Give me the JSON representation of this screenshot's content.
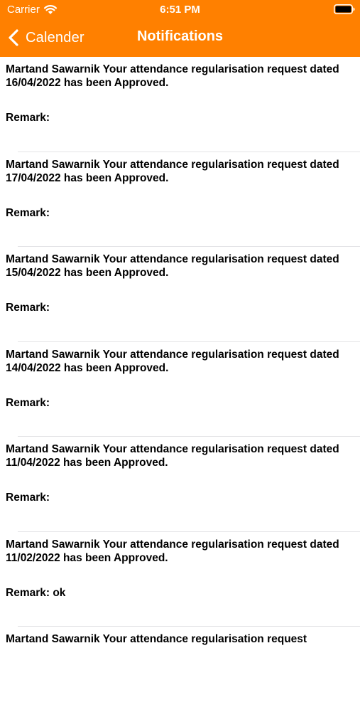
{
  "status_bar": {
    "carrier": "Carrier",
    "time": "6:51 PM"
  },
  "nav": {
    "back_label": "Calender",
    "title": "Notifications"
  },
  "colors": {
    "header": "#ff8000",
    "text": "#000000",
    "separator": "#e3e3e6"
  },
  "notifications": [
    {
      "message": "Martand Sawarnik Your attendance regularisation request dated 16/04/2022 has been Approved.",
      "remark": "Remark:"
    },
    {
      "message": "Martand Sawarnik Your attendance regularisation request dated 17/04/2022 has been Approved.",
      "remark": "Remark:"
    },
    {
      "message": "Martand Sawarnik Your attendance regularisation request dated 15/04/2022 has been Approved.",
      "remark": "Remark:"
    },
    {
      "message": "Martand Sawarnik Your attendance regularisation request dated 14/04/2022 has been Approved.",
      "remark": "Remark:"
    },
    {
      "message": "Martand Sawarnik Your attendance regularisation request dated 11/04/2022 has been Approved.",
      "remark": "Remark:"
    },
    {
      "message": "Martand Sawarnik Your attendance regularisation request dated 11/02/2022 has been Approved.",
      "remark": "Remark: ok"
    },
    {
      "message": "Martand Sawarnik Your attendance regularisation request",
      "remark": ""
    }
  ]
}
